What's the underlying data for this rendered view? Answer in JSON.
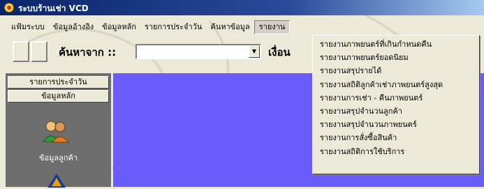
{
  "window": {
    "title": "ระบบร้านเช่า VCD"
  },
  "menu": [
    "แฟ้มระบบ",
    "ข้อมูลอ้างอิง",
    "ข้อมูลหลัก",
    "รายการประจำวัน",
    "ค้นหาข้อมูล",
    "รายงาน"
  ],
  "toolbar": {
    "search_label": "ค้นหาจาก ::",
    "search_value": "",
    "condition_label": "เงื่อน"
  },
  "sidebar": {
    "daily_button": "รายการประจำวัน",
    "master_button": "ข้อมูลหลัก",
    "customer_label": "ข้อมูลลูกค้า"
  },
  "report_menu": {
    "items": [
      "รายงานภาพยนตร์ที่เกินกำหนดคืน",
      "รายงานภาพยนตร์ยอดนิยม",
      "รายงานสรุปรายได้",
      "รายงานสถิติลูกค้าเช่าภาพยนตร์สูงสุด",
      "รายงานการเช่า - คืนภาพยนตร์",
      "รายงานสรุปจำนวนลูกค้า",
      "รายงานสรุปจำนวนภาพยนตร์",
      "รายงานการสั่งซื้อสินค้า",
      "รายงานสถิติการใช้บริการ"
    ]
  },
  "colors": {
    "titlebar": "#0a246a",
    "main_area": "#6a5cf8",
    "left_panel": "#6e6e6e"
  }
}
